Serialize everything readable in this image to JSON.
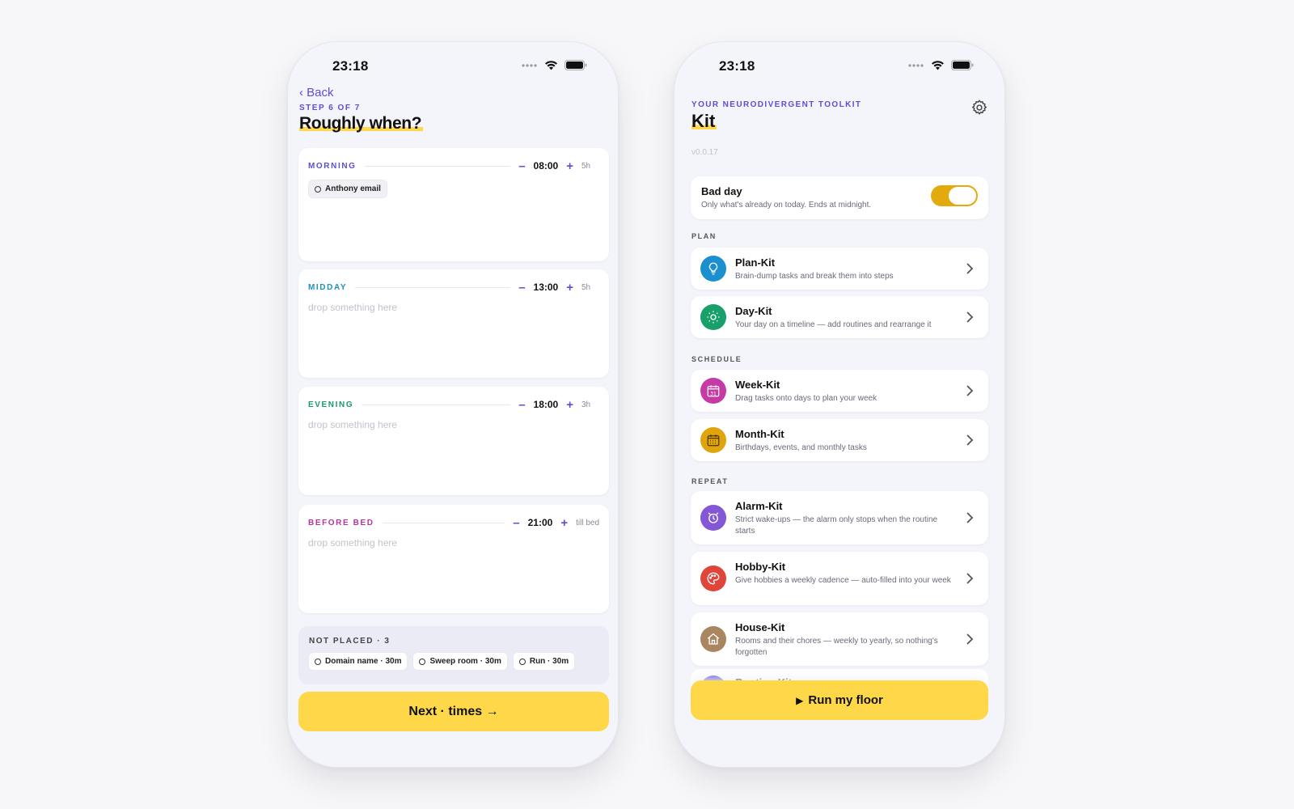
{
  "left_phone": {
    "status": {
      "time": "23:18"
    },
    "back_label": "‹ Back",
    "step_label": "STEP 6 OF 7",
    "title": "Roughly when?",
    "slots": [
      {
        "name": "MORNING",
        "color": "#5b4fd6",
        "time": "08:00",
        "duration": "5h",
        "chips": [
          "Anthony email"
        ],
        "placeholder": ""
      },
      {
        "name": "MIDDAY",
        "color": "#1f8fc0",
        "time": "13:00",
        "duration": "5h",
        "chips": [],
        "placeholder": "drop something here"
      },
      {
        "name": "EVENING",
        "color": "#1a9a6c",
        "time": "18:00",
        "duration": "3h",
        "chips": [],
        "placeholder": "drop something here"
      },
      {
        "name": "BEFORE BED",
        "color": "#b3359f",
        "time": "21:00",
        "duration": "till bed",
        "chips": [],
        "placeholder": "drop something here"
      }
    ],
    "minus_glyph": "–",
    "plus_glyph": "+",
    "unplaced": {
      "label": "NOT PLACED · 3",
      "chips": [
        "Domain name · 30m",
        "Sweep room · 30m",
        "Run · 30m"
      ]
    },
    "next_button": "Next · times →"
  },
  "right_phone": {
    "status": {
      "time": "23:18"
    },
    "subtitle": "YOUR NEURODIVERGENT TOOLKIT",
    "title": "Kit",
    "version": "v0.0.17",
    "bad_day": {
      "title": "Bad day",
      "description": "Only what's already on today. Ends at midnight.",
      "enabled": true
    },
    "sections": {
      "plan": "PLAN",
      "schedule": "SCHEDULE",
      "repeat": "REPEAT"
    },
    "kits": [
      {
        "title": "Plan-Kit",
        "description": "Brain-dump tasks and break them into steps",
        "icon": "lightbulb-icon",
        "color": "#1b8fd0"
      },
      {
        "title": "Day-Kit",
        "description": "Your day on a timeline — add routines and rearrange it",
        "icon": "sun-icon",
        "color": "#19a06a"
      },
      {
        "title": "Week-Kit",
        "description": "Drag tasks onto days to plan your week",
        "icon": "calendar-31-icon",
        "color": "#c53aa5"
      },
      {
        "title": "Month-Kit",
        "description": "Birthdays, events, and monthly tasks",
        "icon": "calendar-grid-icon",
        "color": "#e0a40c"
      },
      {
        "title": "Alarm-Kit",
        "description": "Strict wake-ups — the alarm only stops when the routine starts",
        "icon": "alarm-clock-icon",
        "color": "#8457d6"
      },
      {
        "title": "Hobby-Kit",
        "description": "Give hobbies a weekly cadence — auto-filled into your week",
        "icon": "palette-icon",
        "color": "#e0453a"
      },
      {
        "title": "House-Kit",
        "description": "Rooms and their chores — weekly to yearly, so nothing's forgotten",
        "icon": "house-icon",
        "color": "#a98560"
      }
    ],
    "peek_title": "Routine-Kit",
    "run_button": "Run my floor",
    "run_glyph": "▶"
  },
  "colors": {
    "accent": "#5b4fd6",
    "button_yellow": "#ffd84a",
    "toggle_on": "#e2aa0c"
  }
}
